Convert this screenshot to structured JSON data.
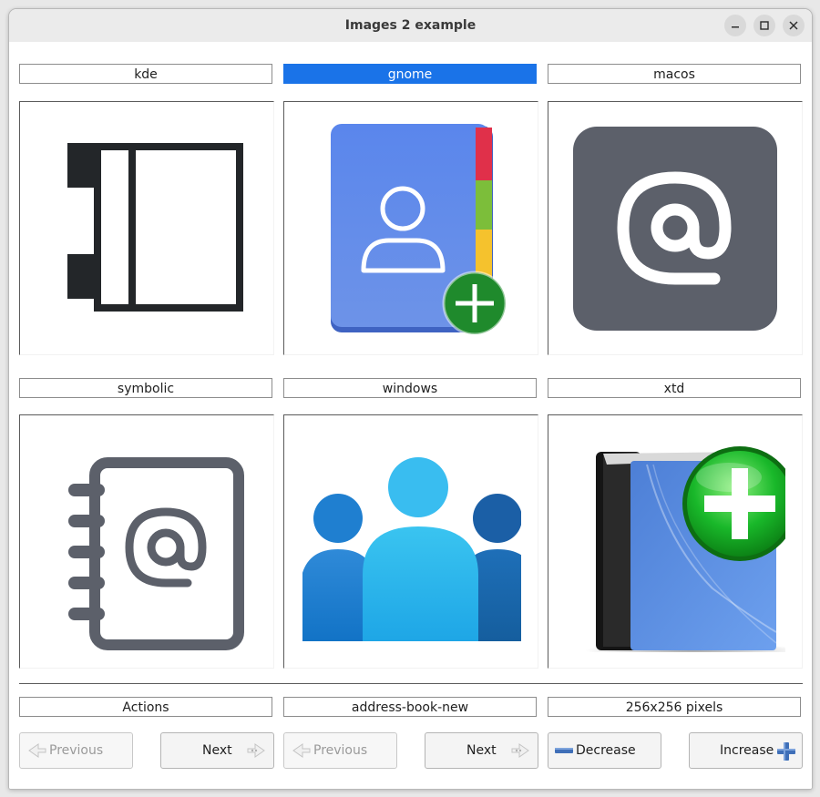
{
  "window": {
    "title": "Images 2 example"
  },
  "grid": {
    "labels": [
      "kde",
      "gnome",
      "macos",
      "symbolic",
      "windows",
      "xtd"
    ],
    "icons": [
      "kde-address-book-icon",
      "gnome-address-book-new-icon",
      "macos-address-book-icon",
      "symbolic-address-book-icon",
      "windows-people-icon",
      "xtd-address-book-new-icon"
    ],
    "selected": "gnome"
  },
  "status": {
    "group": "Actions",
    "name": "address-book-new",
    "size": "256x256 pixels"
  },
  "buttons": {
    "group_previous": "Previous",
    "group_next": "Next",
    "name_previous": "Previous",
    "name_next": "Next",
    "decrease": "Decrease",
    "increase": "Increase"
  },
  "colors": {
    "selection": "#1a73e8",
    "gnome_blue": "#5b86ea",
    "macos_gray": "#5c606a",
    "xtd_green": "#1aa31a"
  }
}
